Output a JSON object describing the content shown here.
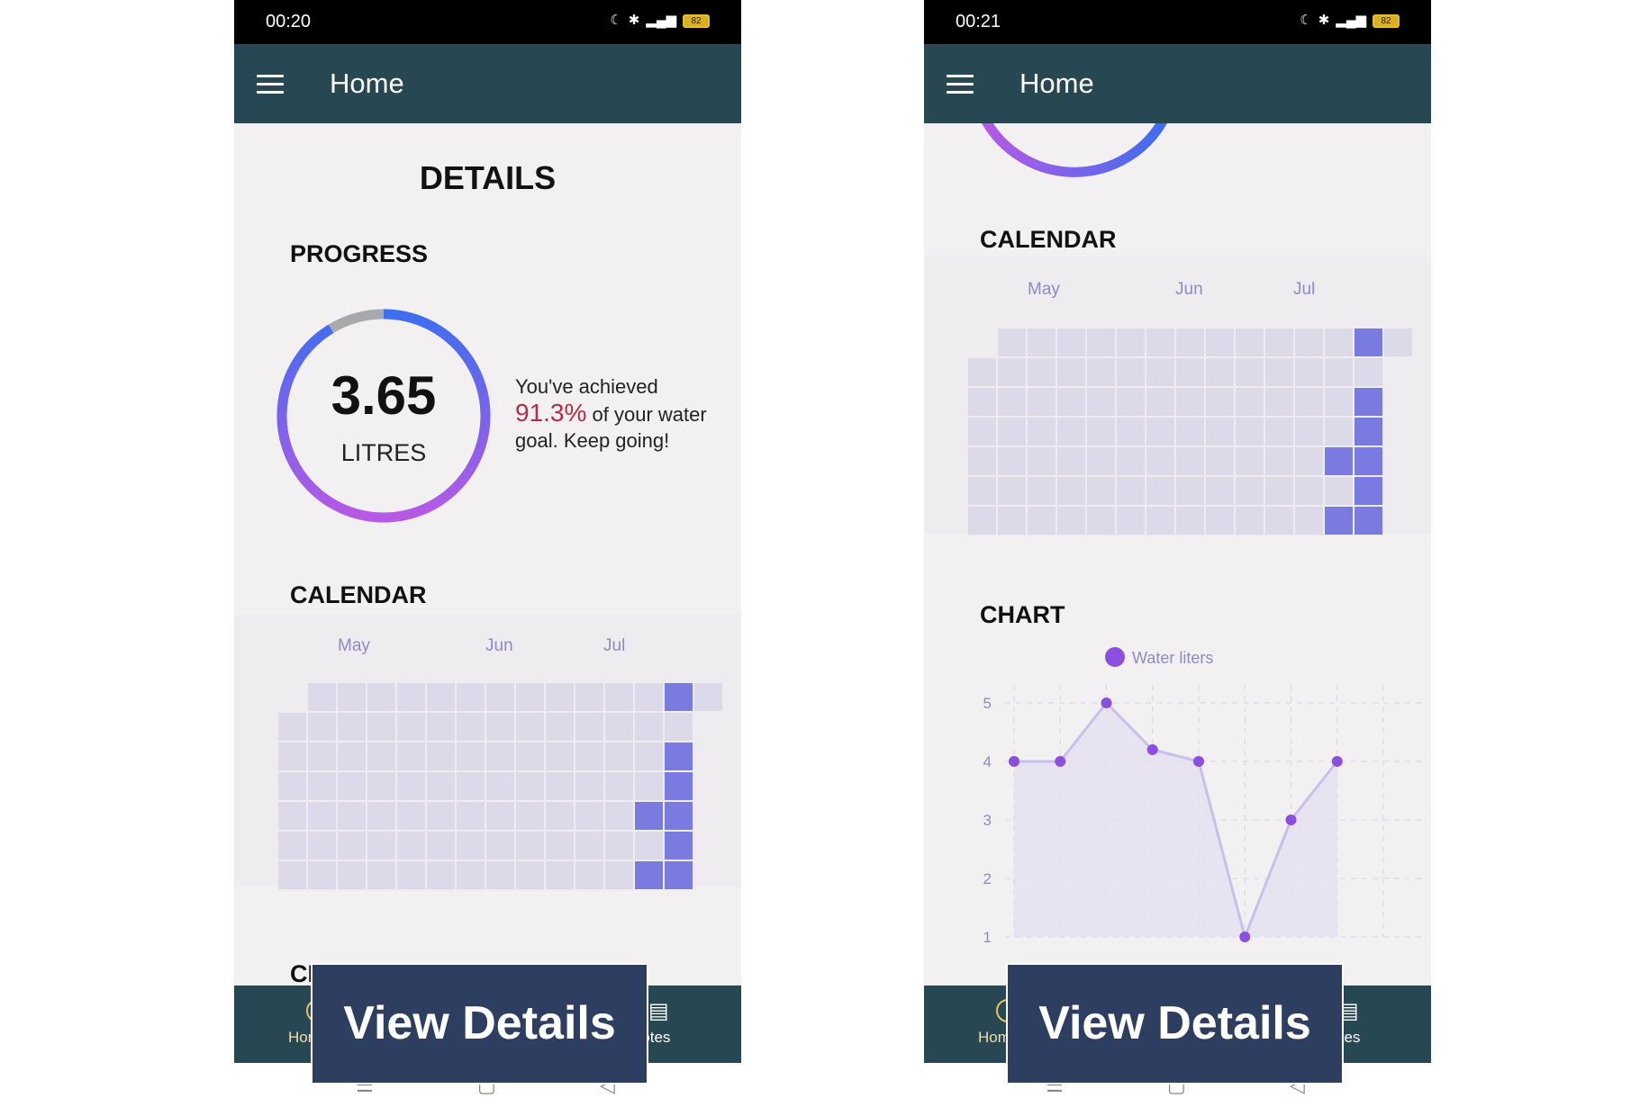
{
  "screens": [
    {
      "status_time": "00:20",
      "app_title": "Home",
      "details_title": "DETAILS",
      "progress_title": "PROGRESS",
      "progress_value": "3.65",
      "progress_unit": "LITRES",
      "progress_fraction": 0.913,
      "progress_text_before": "You've achieved",
      "progress_percent": "91.3%",
      "progress_text_after": "of your water goal. Keep going!",
      "calendar_title": "CALENDAR",
      "chart_title_partial": "CHART",
      "cta": "View Details",
      "nav_home": "Home",
      "nav_notes": "Notes"
    },
    {
      "status_time": "00:21",
      "app_title": "Home",
      "calendar_title": "CALENDAR",
      "chart_title": "CHART",
      "cta": "View Details",
      "nav_home": "Home",
      "nav_notes": "Notes"
    }
  ],
  "status": {
    "battery": "82",
    "network": "4G"
  },
  "calendar": {
    "months": [
      "May",
      "Jun",
      "Jul"
    ],
    "filled_cells": [
      [
        13,
        0
      ],
      [
        13,
        2
      ],
      [
        13,
        3
      ],
      [
        12,
        4
      ],
      [
        13,
        4
      ],
      [
        13,
        5
      ],
      [
        12,
        6
      ],
      [
        13,
        6
      ]
    ]
  },
  "chart_data": {
    "type": "area",
    "series": [
      {
        "name": "Water liters",
        "values": [
          4,
          4,
          5,
          4.2,
          4,
          1,
          3,
          4
        ]
      }
    ],
    "x": [
      1,
      2,
      3,
      4,
      5,
      6,
      7,
      8
    ],
    "yticks": [
      "1",
      "2",
      "3",
      "4",
      "5"
    ],
    "ylim": [
      1,
      5
    ],
    "grid": true,
    "legend": "top",
    "colors": {
      "line": "#c7c0ea",
      "point": "#8b4fe0",
      "fill": "#e3e0f0"
    }
  },
  "colors": {
    "appbar": "#274753",
    "accent_percent": "#b03045",
    "cta": "#2d3e61",
    "calendar_filled": "#7a7be0",
    "calendar_empty": "#dcdae8"
  }
}
